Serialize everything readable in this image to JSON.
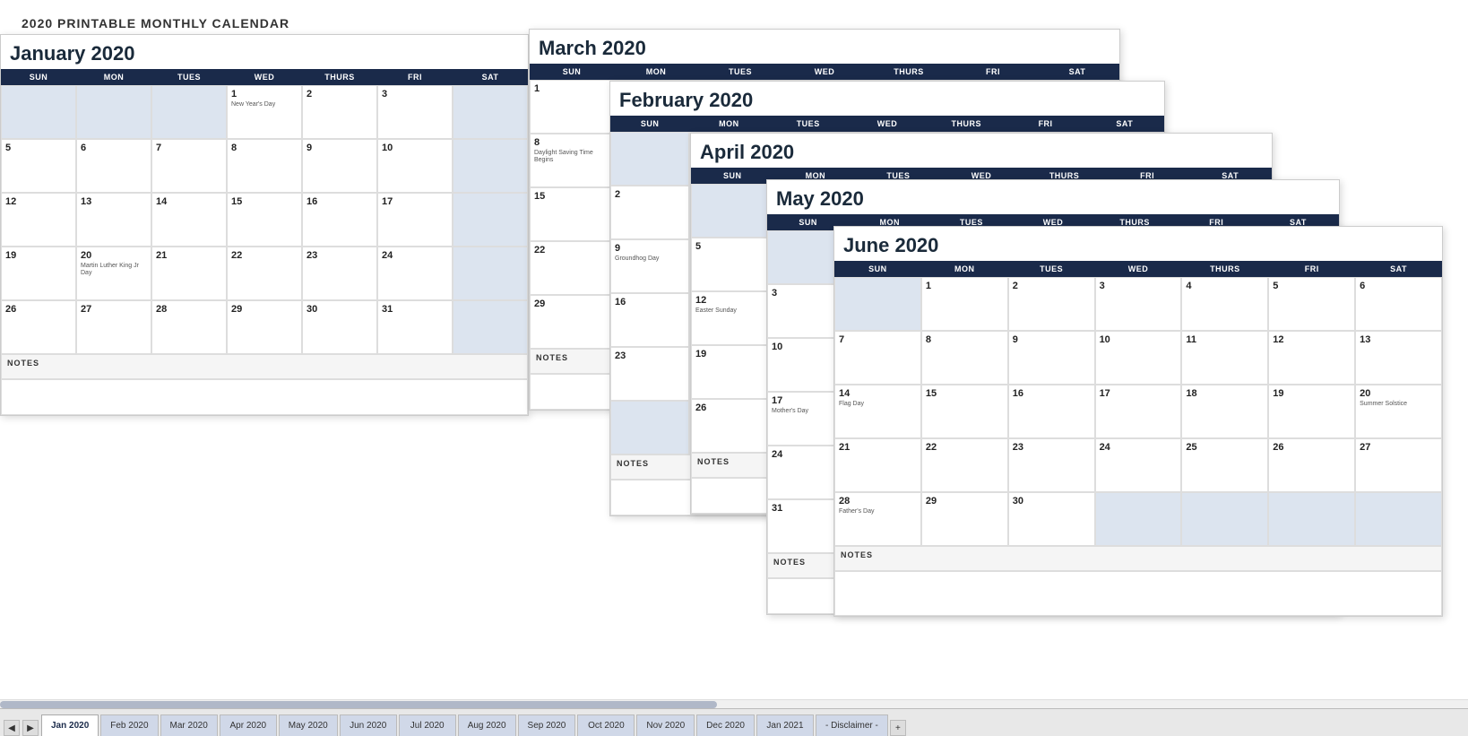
{
  "page": {
    "title": "2020 PRINTABLE MONTHLY CALENDAR"
  },
  "tabs": [
    {
      "label": "Jan 2020",
      "active": true
    },
    {
      "label": "Feb 2020",
      "active": false
    },
    {
      "label": "Mar 2020",
      "active": false
    },
    {
      "label": "Apr 2020",
      "active": false
    },
    {
      "label": "May 2020",
      "active": false
    },
    {
      "label": "Jun 2020",
      "active": false
    },
    {
      "label": "Jul 2020",
      "active": false
    },
    {
      "label": "Aug 2020",
      "active": false
    },
    {
      "label": "Sep 2020",
      "active": false
    },
    {
      "label": "Oct 2020",
      "active": false
    },
    {
      "label": "Nov 2020",
      "active": false
    },
    {
      "label": "Dec 2020",
      "active": false
    },
    {
      "label": "Jan 2021",
      "active": false
    },
    {
      "label": "- Disclaimer -",
      "active": false
    }
  ],
  "calendars": {
    "january": {
      "title": "January 2020",
      "days": [
        "SUN",
        "MON",
        "TUES",
        "WED",
        "THURS",
        "FRI",
        "SAT"
      ]
    },
    "march": {
      "title": "March 2020",
      "days": [
        "SUN",
        "MON",
        "TUES",
        "WED",
        "THURS",
        "FRI",
        "SAT"
      ]
    },
    "february": {
      "title": "February 2020",
      "days": [
        "SUN",
        "MON",
        "TUES",
        "WED",
        "THURS",
        "FRI",
        "SAT"
      ]
    },
    "april": {
      "title": "April 2020",
      "days": [
        "SUN",
        "MON",
        "TUES",
        "WED",
        "THURS",
        "FRI",
        "SAT"
      ]
    },
    "may": {
      "title": "May 2020",
      "days": [
        "SUN",
        "MON",
        "TUES",
        "WED",
        "THURS",
        "FRI",
        "SAT"
      ]
    },
    "june": {
      "title": "June 2020",
      "days": [
        "SUN",
        "MON",
        "TUES",
        "WED",
        "THURS",
        "FRI",
        "SAT"
      ]
    }
  },
  "notes_label": "NOTES"
}
